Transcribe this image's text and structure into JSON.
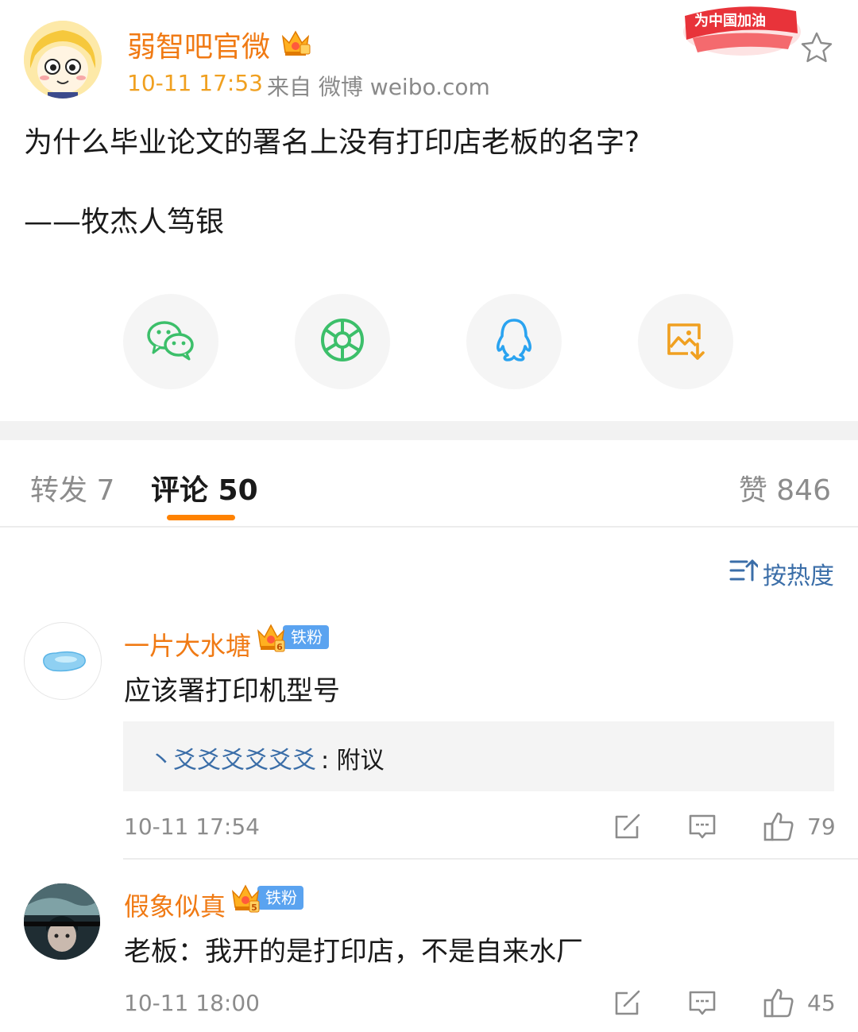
{
  "post": {
    "author": "弱智吧官微",
    "time": "10-11 17:53",
    "source": "来自 微博 weibo.com",
    "text": "为什么毕业论文的署名上没有打印店老板的名字?",
    "signature": "——牧杰人笃银",
    "promo_text": "为中国加油"
  },
  "share": {
    "icons": [
      "wechat-icon",
      "moments-icon",
      "qq-icon",
      "save-image-icon"
    ]
  },
  "tabs": {
    "repost": "转发 7",
    "comments": "评论 50",
    "likes": "赞 846"
  },
  "sort": {
    "label": "按热度"
  },
  "comments": [
    {
      "name": "一片大水塘",
      "badge": "铁粉",
      "badge_level": "6",
      "text": "应该署打印机型号",
      "reply_prefix": "丶爻爻爻爻爻爻",
      "reply_text": ": 附议",
      "time": "10-11 17:54",
      "likes": "79"
    },
    {
      "name": "假象似真",
      "badge": "铁粉",
      "badge_level": "5",
      "text": "老板：我开的是打印店，不是自来水厂",
      "time": "10-11 18:00",
      "likes": "45"
    }
  ],
  "colors": {
    "accent": "#ff8200",
    "author_name": "#f07a14",
    "link_blue": "#3b6ea8",
    "fan_badge": "#5aa3f0",
    "promo_red": "#e8333a"
  }
}
